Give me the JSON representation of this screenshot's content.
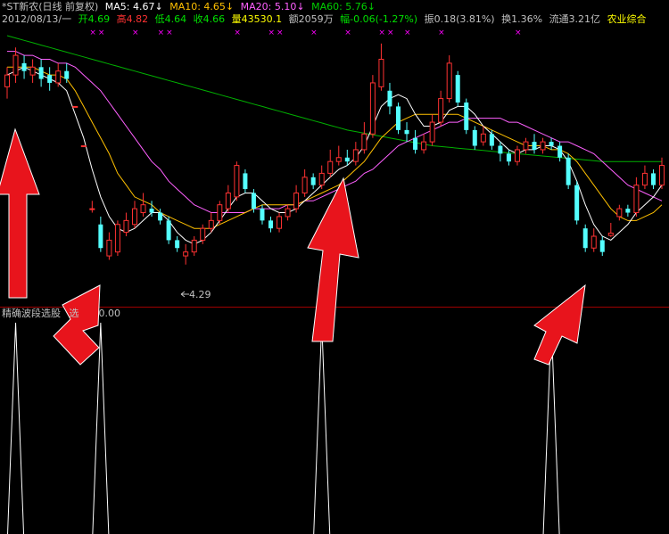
{
  "header": {
    "title": "*ST新农(日线 前复权)",
    "ma5": "MA5: 4.67↓",
    "ma10": "MA10: 4.65↓",
    "ma20": "MA20: 5.10↓",
    "ma60": "MA60: 5.76↓",
    "date": "2012/08/13/一",
    "open": "开4.69",
    "high": "高4.82",
    "low": "低4.64",
    "close": "收4.66",
    "volume": "量43530.1",
    "amount": "额2059万",
    "change": "幅-0.06(-1.27%)",
    "amplitude": "振0.18(3.81%)",
    "turnover": "换1.36%",
    "float": "流通3.21亿",
    "sector": "农业综合"
  },
  "colors": {
    "background": "#000000",
    "up": "#ff3232",
    "down": "#54ffff",
    "ma5": "#ffffff",
    "ma10": "#ffc000",
    "ma20": "#ff60ff",
    "ma60": "#00b000",
    "marker": "#ff00ff",
    "divider": "#a00000",
    "arrow": "#e8141c"
  },
  "indicator": {
    "name": "精确波段选股",
    "value_text": "选",
    "value_tail": "0.00"
  },
  "chart_data": {
    "type": "candlestick",
    "y_range": [
      3.8,
      7.2
    ],
    "min_marker": "4.29",
    "candles": [
      {
        "o": 6.55,
        "c": 6.7,
        "h": 6.8,
        "l": 6.4
      },
      {
        "o": 6.7,
        "c": 6.95,
        "h": 7.05,
        "l": 6.6
      },
      {
        "o": 6.85,
        "c": 6.75,
        "h": 6.95,
        "l": 6.65
      },
      {
        "o": 6.7,
        "c": 6.8,
        "h": 6.9,
        "l": 6.6
      },
      {
        "o": 6.8,
        "c": 6.65,
        "h": 6.9,
        "l": 6.55
      },
      {
        "o": 6.7,
        "c": 6.6,
        "h": 6.8,
        "l": 6.5
      },
      {
        "o": 6.6,
        "c": 6.75,
        "h": 6.85,
        "l": 6.55
      },
      {
        "o": 6.75,
        "c": 6.65,
        "h": 6.85,
        "l": 6.6
      },
      {
        "o": 6.3,
        "c": 6.3,
        "h": 6.3,
        "l": 6.3
      },
      {
        "o": 5.8,
        "c": 5.8,
        "h": 5.8,
        "l": 5.8
      },
      {
        "o": 5.0,
        "c": 5.0,
        "h": 5.1,
        "l": 4.95
      },
      {
        "o": 4.8,
        "c": 4.5,
        "h": 4.9,
        "l": 4.45
      },
      {
        "o": 4.4,
        "c": 4.6,
        "h": 4.7,
        "l": 4.35
      },
      {
        "o": 4.45,
        "c": 4.8,
        "h": 4.85,
        "l": 4.4
      },
      {
        "o": 4.7,
        "c": 4.85,
        "h": 4.95,
        "l": 4.65
      },
      {
        "o": 4.8,
        "c": 5.0,
        "h": 5.1,
        "l": 4.75
      },
      {
        "o": 4.95,
        "c": 5.05,
        "h": 5.2,
        "l": 4.9
      },
      {
        "o": 5.0,
        "c": 4.95,
        "h": 5.1,
        "l": 4.9
      },
      {
        "o": 4.95,
        "c": 4.85,
        "h": 5.0,
        "l": 4.8
      },
      {
        "o": 4.85,
        "c": 4.6,
        "h": 4.9,
        "l": 4.55
      },
      {
        "o": 4.6,
        "c": 4.5,
        "h": 4.65,
        "l": 4.45
      },
      {
        "o": 4.4,
        "c": 4.45,
        "h": 4.55,
        "l": 4.29
      },
      {
        "o": 4.45,
        "c": 4.6,
        "h": 4.65,
        "l": 4.4
      },
      {
        "o": 4.6,
        "c": 4.75,
        "h": 4.8,
        "l": 4.55
      },
      {
        "o": 4.75,
        "c": 4.85,
        "h": 4.95,
        "l": 4.7
      },
      {
        "o": 4.85,
        "c": 5.05,
        "h": 5.1,
        "l": 4.8
      },
      {
        "o": 5.0,
        "c": 5.2,
        "h": 5.3,
        "l": 4.95
      },
      {
        "o": 5.15,
        "c": 5.55,
        "h": 5.6,
        "l": 5.1
      },
      {
        "o": 5.45,
        "c": 5.25,
        "h": 5.5,
        "l": 5.2
      },
      {
        "o": 5.2,
        "c": 5.0,
        "h": 5.25,
        "l": 4.95
      },
      {
        "o": 5.0,
        "c": 4.85,
        "h": 5.05,
        "l": 4.8
      },
      {
        "o": 4.85,
        "c": 4.75,
        "h": 4.9,
        "l": 4.7
      },
      {
        "o": 4.75,
        "c": 4.9,
        "h": 4.95,
        "l": 4.7
      },
      {
        "o": 4.9,
        "c": 5.0,
        "h": 5.05,
        "l": 4.85
      },
      {
        "o": 5.0,
        "c": 5.2,
        "h": 5.3,
        "l": 4.95
      },
      {
        "o": 5.2,
        "c": 5.4,
        "h": 5.5,
        "l": 5.15
      },
      {
        "o": 5.4,
        "c": 5.3,
        "h": 5.45,
        "l": 5.25
      },
      {
        "o": 5.3,
        "c": 5.45,
        "h": 5.55,
        "l": 5.25
      },
      {
        "o": 5.45,
        "c": 5.6,
        "h": 5.75,
        "l": 5.4
      },
      {
        "o": 5.6,
        "c": 5.65,
        "h": 5.8,
        "l": 5.55
      },
      {
        "o": 5.65,
        "c": 5.6,
        "h": 5.75,
        "l": 5.55
      },
      {
        "o": 5.6,
        "c": 5.75,
        "h": 5.85,
        "l": 5.55
      },
      {
        "o": 5.75,
        "c": 5.95,
        "h": 6.1,
        "l": 5.7
      },
      {
        "o": 5.95,
        "c": 6.6,
        "h": 6.7,
        "l": 5.9
      },
      {
        "o": 6.55,
        "c": 6.9,
        "h": 7.1,
        "l": 6.5
      },
      {
        "o": 6.5,
        "c": 6.3,
        "h": 6.6,
        "l": 6.2
      },
      {
        "o": 6.3,
        "c": 6.0,
        "h": 6.35,
        "l": 5.95
      },
      {
        "o": 6.0,
        "c": 5.95,
        "h": 6.1,
        "l": 5.85
      },
      {
        "o": 5.9,
        "c": 5.75,
        "h": 6.0,
        "l": 5.7
      },
      {
        "o": 5.75,
        "c": 5.85,
        "h": 5.95,
        "l": 5.7
      },
      {
        "o": 5.85,
        "c": 6.1,
        "h": 6.2,
        "l": 5.8
      },
      {
        "o": 6.1,
        "c": 6.4,
        "h": 6.5,
        "l": 6.05
      },
      {
        "o": 6.4,
        "c": 6.85,
        "h": 6.95,
        "l": 6.35
      },
      {
        "o": 6.7,
        "c": 6.35,
        "h": 6.75,
        "l": 6.3
      },
      {
        "o": 6.35,
        "c": 6.0,
        "h": 6.4,
        "l": 5.95
      },
      {
        "o": 6.0,
        "c": 5.8,
        "h": 6.05,
        "l": 5.75
      },
      {
        "o": 5.85,
        "c": 5.95,
        "h": 6.05,
        "l": 5.8
      },
      {
        "o": 5.95,
        "c": 5.8,
        "h": 6.0,
        "l": 5.75
      },
      {
        "o": 5.8,
        "c": 5.7,
        "h": 5.85,
        "l": 5.6
      },
      {
        "o": 5.7,
        "c": 5.6,
        "h": 5.75,
        "l": 5.55
      },
      {
        "o": 5.6,
        "c": 5.75,
        "h": 5.8,
        "l": 5.55
      },
      {
        "o": 5.75,
        "c": 5.85,
        "h": 5.9,
        "l": 5.7
      },
      {
        "o": 5.85,
        "c": 5.75,
        "h": 5.95,
        "l": 5.7
      },
      {
        "o": 5.75,
        "c": 5.85,
        "h": 5.9,
        "l": 5.7
      },
      {
        "o": 5.85,
        "c": 5.8,
        "h": 5.9,
        "l": 5.75
      },
      {
        "o": 5.8,
        "c": 5.65,
        "h": 5.85,
        "l": 5.6
      },
      {
        "o": 5.65,
        "c": 5.3,
        "h": 5.7,
        "l": 5.25
      },
      {
        "o": 5.3,
        "c": 4.85,
        "h": 5.35,
        "l": 4.8
      },
      {
        "o": 4.75,
        "c": 4.5,
        "h": 4.8,
        "l": 4.45
      },
      {
        "o": 4.5,
        "c": 4.65,
        "h": 4.75,
        "l": 4.45
      },
      {
        "o": 4.6,
        "c": 4.45,
        "h": 4.65,
        "l": 4.4
      },
      {
        "o": 4.66,
        "c": 4.69,
        "h": 4.82,
        "l": 4.64
      },
      {
        "o": 4.9,
        "c": 5.0,
        "h": 5.05,
        "l": 4.85
      },
      {
        "o": 5.0,
        "c": 4.95,
        "h": 5.05,
        "l": 4.9
      },
      {
        "o": 4.95,
        "c": 5.3,
        "h": 5.4,
        "l": 4.9
      },
      {
        "o": 5.3,
        "c": 5.45,
        "h": 5.55,
        "l": 5.25
      },
      {
        "o": 5.45,
        "c": 5.3,
        "h": 5.5,
        "l": 5.25
      },
      {
        "o": 5.3,
        "c": 5.55,
        "h": 5.65,
        "l": 5.25
      }
    ],
    "ma5": [
      6.7,
      6.75,
      6.8,
      6.75,
      6.7,
      6.65,
      6.6,
      6.5,
      6.2,
      5.9,
      5.5,
      5.15,
      4.9,
      4.75,
      4.7,
      4.75,
      4.85,
      4.95,
      4.95,
      4.85,
      4.7,
      4.6,
      4.55,
      4.6,
      4.7,
      4.85,
      5.0,
      5.15,
      5.2,
      5.2,
      5.1,
      5.0,
      4.95,
      4.95,
      5.0,
      5.1,
      5.2,
      5.3,
      5.4,
      5.5,
      5.55,
      5.65,
      5.8,
      6.05,
      6.3,
      6.4,
      6.45,
      6.4,
      6.2,
      6.05,
      6.05,
      6.1,
      6.25,
      6.3,
      6.3,
      6.2,
      6.05,
      5.95,
      5.85,
      5.75,
      5.7,
      5.75,
      5.75,
      5.8,
      5.8,
      5.75,
      5.6,
      5.35,
      5.05,
      4.8,
      4.65,
      4.6,
      4.7,
      4.8,
      4.95,
      5.05,
      5.15,
      5.3
    ],
    "ma10": [
      6.8,
      6.8,
      6.8,
      6.8,
      6.75,
      6.7,
      6.7,
      6.65,
      6.5,
      6.3,
      6.1,
      5.9,
      5.7,
      5.45,
      5.3,
      5.15,
      5.1,
      5.05,
      4.95,
      4.9,
      4.85,
      4.8,
      4.75,
      4.75,
      4.75,
      4.8,
      4.85,
      4.9,
      4.95,
      5.0,
      5.05,
      5.05,
      5.05,
      5.05,
      5.05,
      5.1,
      5.15,
      5.2,
      5.25,
      5.3,
      5.4,
      5.5,
      5.6,
      5.75,
      5.9,
      6.0,
      6.1,
      6.15,
      6.2,
      6.2,
      6.2,
      6.2,
      6.2,
      6.2,
      6.15,
      6.1,
      6.05,
      6.0,
      5.95,
      5.9,
      5.85,
      5.8,
      5.8,
      5.8,
      5.75,
      5.75,
      5.7,
      5.6,
      5.45,
      5.3,
      5.15,
      5.0,
      4.9,
      4.85,
      4.85,
      4.9,
      4.95,
      5.05
    ],
    "ma20": [
      7.0,
      7.0,
      6.95,
      6.95,
      6.9,
      6.9,
      6.85,
      6.85,
      6.8,
      6.7,
      6.6,
      6.5,
      6.35,
      6.2,
      6.05,
      5.9,
      5.75,
      5.6,
      5.5,
      5.35,
      5.25,
      5.15,
      5.05,
      5.0,
      4.95,
      4.95,
      4.95,
      4.95,
      4.95,
      5.0,
      5.0,
      5.0,
      5.0,
      5.05,
      5.05,
      5.1,
      5.1,
      5.15,
      5.2,
      5.25,
      5.3,
      5.35,
      5.45,
      5.5,
      5.6,
      5.7,
      5.8,
      5.85,
      5.9,
      5.95,
      6.0,
      6.05,
      6.1,
      6.1,
      6.15,
      6.15,
      6.15,
      6.15,
      6.15,
      6.1,
      6.1,
      6.05,
      6.0,
      5.95,
      5.9,
      5.85,
      5.85,
      5.8,
      5.75,
      5.7,
      5.6,
      5.5,
      5.4,
      5.3,
      5.25,
      5.2,
      5.15,
      5.1
    ],
    "ma60": [
      7.2,
      7.17,
      7.14,
      7.11,
      7.08,
      7.05,
      7.02,
      6.99,
      6.96,
      6.93,
      6.9,
      6.87,
      6.84,
      6.81,
      6.78,
      6.75,
      6.72,
      6.69,
      6.66,
      6.63,
      6.6,
      6.57,
      6.54,
      6.51,
      6.48,
      6.45,
      6.42,
      6.39,
      6.36,
      6.33,
      6.3,
      6.27,
      6.24,
      6.21,
      6.18,
      6.15,
      6.12,
      6.09,
      6.06,
      6.03,
      6.0,
      5.98,
      5.96,
      5.94,
      5.92,
      5.9,
      5.88,
      5.86,
      5.84,
      5.82,
      5.8,
      5.79,
      5.78,
      5.77,
      5.76,
      5.75,
      5.74,
      5.73,
      5.72,
      5.71,
      5.7,
      5.69,
      5.68,
      5.67,
      5.66,
      5.65,
      5.64,
      5.63,
      5.62,
      5.61,
      5.6,
      5.6,
      5.6,
      5.6,
      5.6,
      5.6,
      5.6,
      5.6
    ],
    "signal_markers": [
      10,
      11,
      15,
      18,
      19,
      27,
      31,
      32,
      36,
      40,
      44,
      45,
      47,
      51,
      60
    ],
    "indicator_spikes": [
      1,
      11,
      37,
      64
    ]
  }
}
